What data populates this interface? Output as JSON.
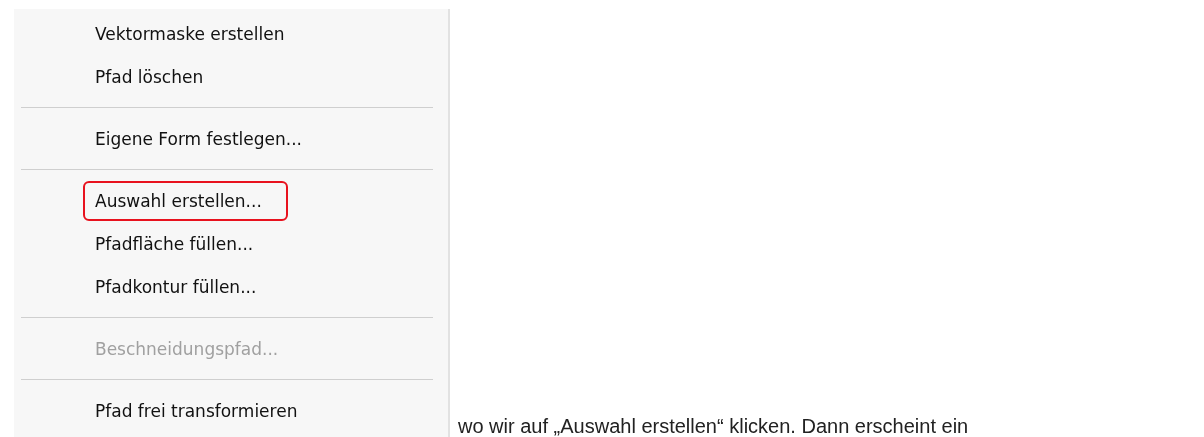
{
  "menu": {
    "items": [
      {
        "kind": "item",
        "label": "Vektormaske erstellen",
        "disabled": false,
        "highlighted": false
      },
      {
        "kind": "item",
        "label": "Pfad löschen",
        "disabled": false,
        "highlighted": false
      },
      {
        "kind": "separator"
      },
      {
        "kind": "item",
        "label": "Eigene Form festlegen...",
        "disabled": false,
        "highlighted": false
      },
      {
        "kind": "separator"
      },
      {
        "kind": "item",
        "label": "Auswahl erstellen...",
        "disabled": false,
        "highlighted": true
      },
      {
        "kind": "item",
        "label": "Pfadfläche füllen...",
        "disabled": false,
        "highlighted": false
      },
      {
        "kind": "item",
        "label": "Pfadkontur füllen...",
        "disabled": false,
        "highlighted": false
      },
      {
        "kind": "separator"
      },
      {
        "kind": "item",
        "label": "Beschneidungspfad...",
        "disabled": true,
        "highlighted": false
      },
      {
        "kind": "separator"
      },
      {
        "kind": "item",
        "label": "Pfad frei transformieren",
        "disabled": false,
        "highlighted": false
      }
    ]
  },
  "paragraph": "wo wir auf „Auswahl erstellen“ klicken. Dann erscheint ein"
}
